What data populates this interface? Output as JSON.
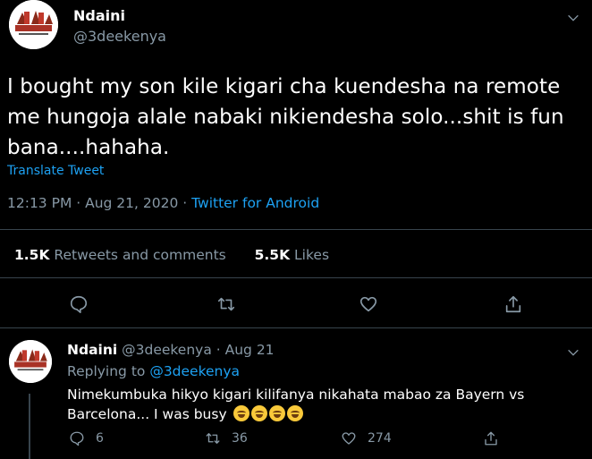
{
  "tweet": {
    "display_name": "Ndaini",
    "handle": "@3deekenya",
    "text": "I bought my son kile kigari cha kuendesha na remote me hungoja alale nabaki nikiendesha solo...shit is fun bana....hahaha.",
    "translate_label": "Translate Tweet",
    "timestamp": "12:13 PM · Aug 21, 2020 · ",
    "source": "Twitter for Android",
    "retweets_count": "1.5K",
    "retweets_label": "Retweets and comments",
    "likes_count": "5.5K",
    "likes_label": "Likes"
  },
  "reply": {
    "display_name": "Ndaini",
    "meta": " @3deekenya · Aug 21",
    "replying_prefix": "Replying to ",
    "replying_mention": "@3deekenya",
    "text": "Nimekumbuka hikyo kigari kilifanya nikahata mabao za Bayern vs Barcelona... I was busy",
    "reply_count": "6",
    "retweet_count": "36",
    "like_count": "274"
  },
  "icons": {
    "caret": "chevron-down-icon",
    "comment": "comment-icon",
    "retweet": "retweet-icon",
    "like": "heart-icon",
    "share": "share-icon",
    "emoji": "joy-emoji-icon"
  },
  "colors": {
    "background": "#000000",
    "link": "#1da1f2",
    "secondary_text": "#8899a6",
    "divider": "#38444d"
  }
}
